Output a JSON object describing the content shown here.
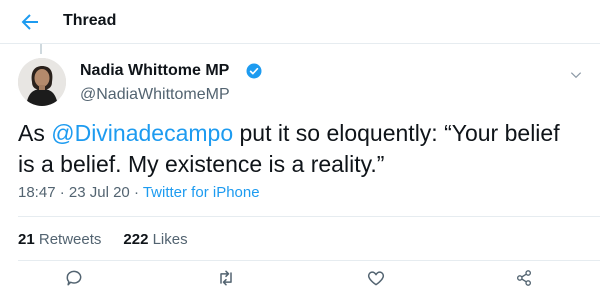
{
  "header": {
    "title": "Thread",
    "back_icon": "back-arrow-icon",
    "accent": "#1d9bf0"
  },
  "author": {
    "name": "Nadia Whittome MP",
    "handle": "@NadiaWhittomeMP",
    "verified": true
  },
  "tweet": {
    "prefix": "As ",
    "mention": "@Divinadecampo",
    "body": " put it so eloquently: “Your belief is a belief. My existence is a reality.”"
  },
  "meta": {
    "time": "18:47",
    "sep1": " · ",
    "date": "23 Jul 20",
    "sep2": " · ",
    "source": "Twitter for iPhone"
  },
  "stats": {
    "retweets_count": "21",
    "retweets_label": "Retweets",
    "likes_count": "222",
    "likes_label": "Likes"
  },
  "actions": [
    "reply-icon",
    "retweet-icon",
    "like-icon",
    "share-icon"
  ]
}
